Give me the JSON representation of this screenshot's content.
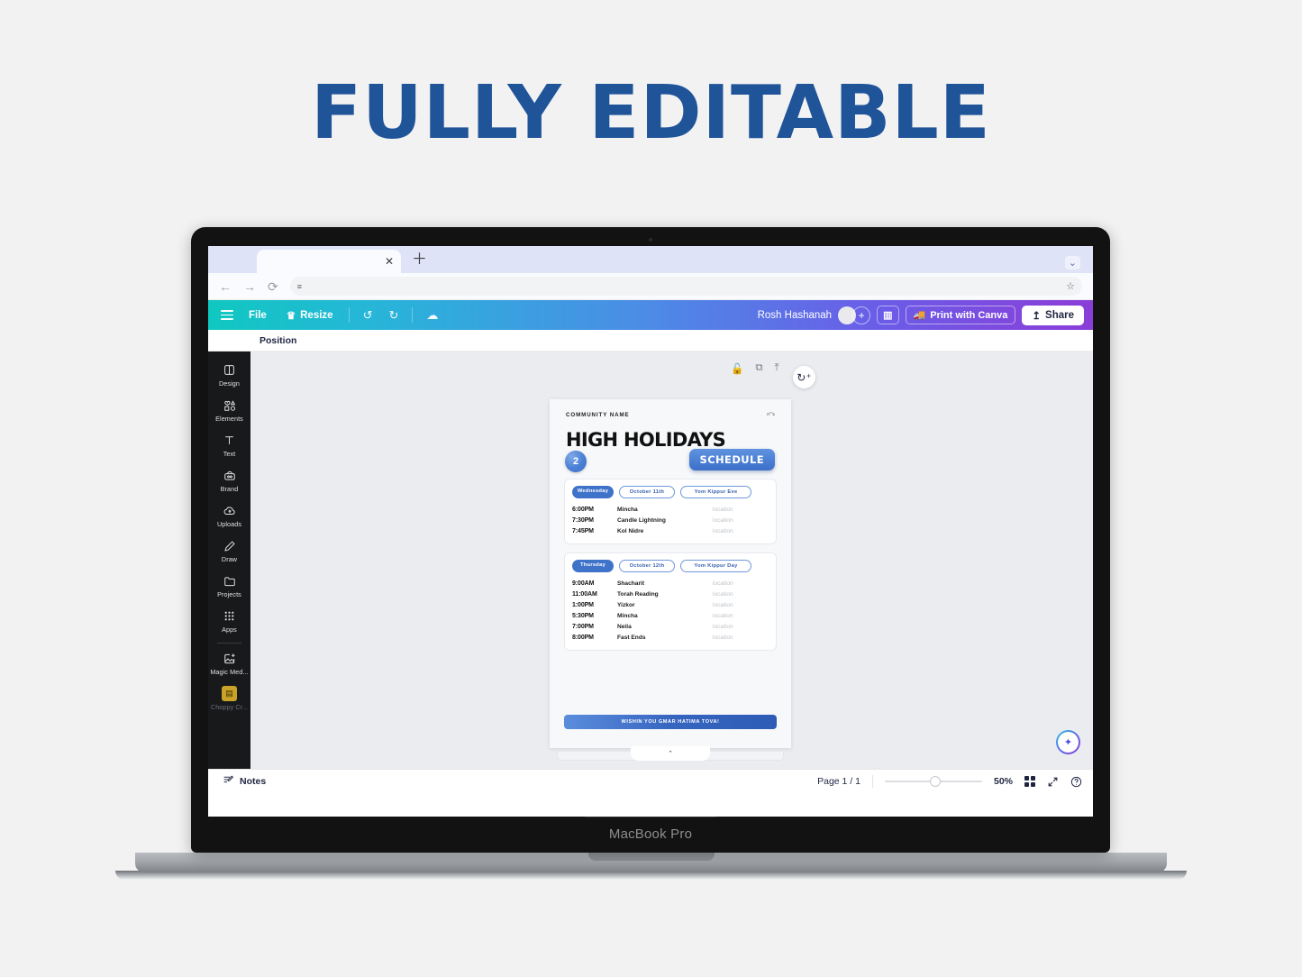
{
  "headline": "FULLY EDITABLE",
  "accent_color": "#1f5499",
  "laptop": {
    "model_label": "MacBook Pro"
  },
  "browser": {
    "tab_title": "",
    "tab_close_icon": "close-icon",
    "new_tab_icon": "plus-icon",
    "tab_list_icon": "chevron-down-icon",
    "back_icon": "back-arrow-icon",
    "forward_icon": "forward-arrow-icon",
    "reload_icon": "reload-icon",
    "url_value": "",
    "url_placeholder": "",
    "site_settings_icon": "sliders-icon",
    "bookmark_icon": "star-icon"
  },
  "canva": {
    "topbar": {
      "menu_icon": "hamburger-icon",
      "file_label": "File",
      "resize_label": "Resize",
      "resize_icon": "crown-icon",
      "undo_icon": "undo-icon",
      "redo_icon": "redo-icon",
      "cloud_icon": "cloud-saved-icon",
      "doc_title": "Rosh Hashanah",
      "avatar_icon": "avatar",
      "add_collaborator_icon": "plus-icon",
      "insights_icon": "bar-chart-icon",
      "print_icon": "truck-icon",
      "print_label": "Print with Canva",
      "share_icon": "upload-icon",
      "share_label": "Share"
    },
    "position_bar": {
      "label": "Position"
    },
    "sidebar": [
      {
        "label": "Design",
        "icon": "design-icon"
      },
      {
        "label": "Elements",
        "icon": "elements-icon"
      },
      {
        "label": "Text",
        "icon": "text-icon"
      },
      {
        "label": "Brand",
        "icon": "brand-icon"
      },
      {
        "label": "Uploads",
        "icon": "uploads-icon"
      },
      {
        "label": "Draw",
        "icon": "draw-icon"
      },
      {
        "label": "Projects",
        "icon": "projects-icon"
      },
      {
        "label": "Apps",
        "icon": "apps-icon"
      },
      {
        "label": "Magic Med...",
        "icon": "magic-media-icon"
      },
      {
        "label": "Choppy Cr...",
        "icon": "app-thumbnail-icon"
      }
    ],
    "float_tools": [
      {
        "icon": "lock-icon"
      },
      {
        "icon": "duplicate-icon"
      },
      {
        "icon": "export-icon"
      }
    ],
    "comment_icon": "add-comment-icon",
    "magic_icon": "sparkle-icon",
    "page_tab_icon": "chevron-up-icon",
    "statusbar": {
      "notes_icon": "notes-icon",
      "notes_label": "Notes",
      "page_count": "Page 1 / 1",
      "zoom_value": "50%",
      "grid_icon": "grid-view-icon",
      "fullscreen_icon": "expand-icon",
      "help_icon": "help-icon"
    }
  },
  "design": {
    "community_name": "COMMUNITY NAME",
    "hebrew_mark": "ב\"ה",
    "title": "HIGH HOLIDAYS",
    "badge_number": "2",
    "schedule_label": "SCHEDULE",
    "blocks": [
      {
        "day": "Wednesday",
        "date": "October 11th",
        "holiday": "Yom Kippur Eve",
        "rows": [
          {
            "time": "6:00PM",
            "event": "Mincha",
            "location": "location"
          },
          {
            "time": "7:30PM",
            "event": "Candle Lightning",
            "location": "location"
          },
          {
            "time": "7:45PM",
            "event": "Kol Nidre",
            "location": "location"
          }
        ]
      },
      {
        "day": "Thursday",
        "date": "October 12th",
        "holiday": "Yom Kippur Day",
        "rows": [
          {
            "time": "9:00AM",
            "event": "Shacharit",
            "location": "location"
          },
          {
            "time": "11:00AM",
            "event": "Torah Reading",
            "location": "location"
          },
          {
            "time": "1:00PM",
            "event": "Yizkor",
            "location": "location"
          },
          {
            "time": "5:30PM",
            "event": "Mincha",
            "location": "location"
          },
          {
            "time": "7:00PM",
            "event": "Neila",
            "location": "location"
          },
          {
            "time": "8:00PM",
            "event": "Fast Ends",
            "location": "location"
          }
        ]
      }
    ],
    "footer_banner": "WISHIN YOU GMAR HATIMA TOVA!"
  }
}
